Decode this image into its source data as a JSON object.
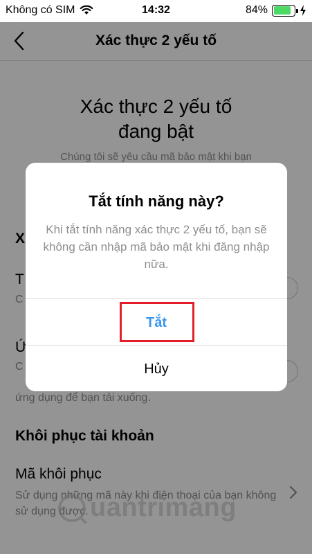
{
  "status_bar": {
    "carrier": "Không có SIM",
    "time": "14:32",
    "battery_percent": "84%",
    "battery_level": 0.84
  },
  "nav": {
    "title": "Xác thực 2 yếu tố"
  },
  "content": {
    "hero_line1": "Xác thực 2 yếu tố",
    "hero_line2": "đang bật",
    "hero_sub": "Chúng tôi sẽ yêu cầu mã bảo mật khi bạn",
    "section_x": "X",
    "row1_letter": "T",
    "row1_sub": "C",
    "row2_letter": "Ứ",
    "row2_sub": "C",
    "line_ungdung": "ứng dụng để bạn tải xuống.",
    "section_recovery": "Khôi phục tài khoản",
    "recovery_item": "Mã khôi phục",
    "recovery_desc": "Sử dụng những mã này khi điện thoại của bạn không sử dụng được."
  },
  "watermark": {
    "text": "uantrimang"
  },
  "dialog": {
    "title": "Tắt tính năng này?",
    "message": "Khi tắt tính năng xác thực 2 yếu tố, bạn sẽ không cần nhập mã bảo mật khi đăng nhập nữa.",
    "confirm_label": "Tắt",
    "cancel_label": "Hủy"
  },
  "colors": {
    "accent": "#3897f0",
    "highlight": "#e41e26",
    "battery": "#4cd964"
  },
  "icons": [
    "wifi-icon",
    "battery-icon",
    "charging-icon",
    "back-chevron-icon",
    "chevron-right-icon"
  ]
}
